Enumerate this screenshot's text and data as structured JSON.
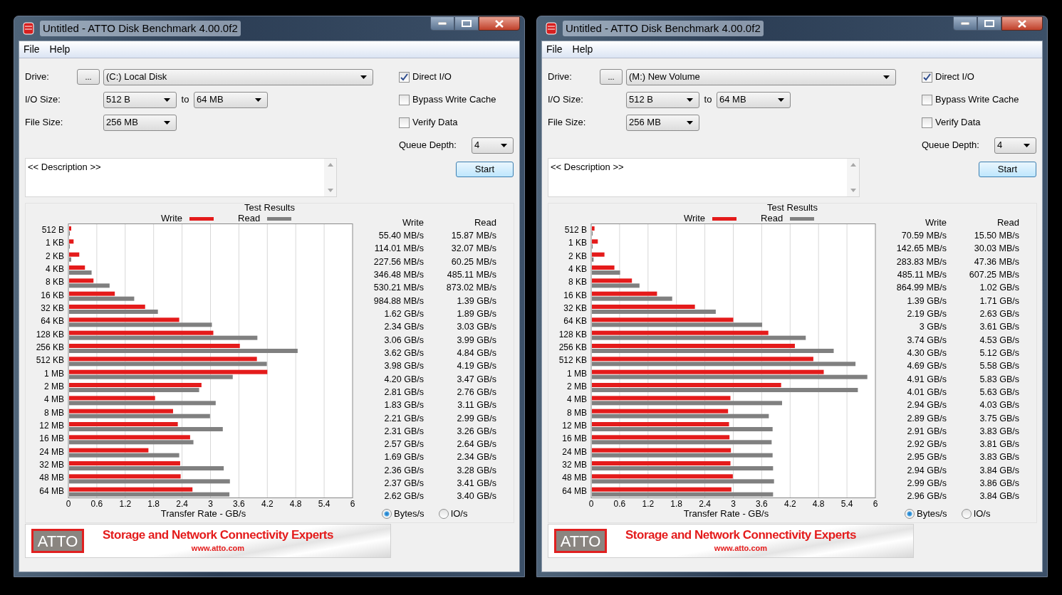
{
  "windows": [
    {
      "title": "Untitled - ATTO Disk Benchmark 4.00.0f2",
      "menu": [
        "File",
        "Help"
      ],
      "drive": {
        "label": "Drive:",
        "browse": "...",
        "value": "(C:) Local Disk"
      },
      "io_size": {
        "label": "I/O Size:",
        "from": "512 B",
        "to_label": "to",
        "to": "64 MB"
      },
      "file_size": {
        "label": "File Size:",
        "value": "256 MB"
      },
      "options": [
        {
          "label": "Direct I/O",
          "checked": true
        },
        {
          "label": "Bypass Write Cache",
          "checked": false
        },
        {
          "label": "Verify Data",
          "checked": false
        }
      ],
      "queue_depth": {
        "label": "Queue Depth:",
        "value": "4"
      },
      "description": "<< Description >>",
      "start": "Start",
      "results": {
        "title": "Test Results",
        "chart_data": {
          "type": "bar",
          "orientation": "horizontal",
          "grid": true,
          "legend": "top",
          "xlabel": "Transfer Rate - GB/s",
          "xlim": [
            0,
            6
          ],
          "xticks": [
            0,
            0.6,
            1.2,
            1.8,
            2.4,
            3,
            3.6,
            4.2,
            4.8,
            5.4,
            6
          ],
          "categories": [
            "512 B",
            "1 KB",
            "2 KB",
            "4 KB",
            "8 KB",
            "16 KB",
            "32 KB",
            "64 KB",
            "128 KB",
            "256 KB",
            "512 KB",
            "1 MB",
            "2 MB",
            "4 MB",
            "8 MB",
            "12 MB",
            "16 MB",
            "24 MB",
            "32 MB",
            "48 MB",
            "64 MB"
          ],
          "series": [
            {
              "name": "Write",
              "color": "#e41b1b",
              "values": [
                0.06,
                0.11,
                0.23,
                0.35,
                0.53,
                0.98,
                1.62,
                2.34,
                3.06,
                3.62,
                3.98,
                4.2,
                2.81,
                1.83,
                2.21,
                2.31,
                2.57,
                1.69,
                2.36,
                2.37,
                2.62
              ]
            },
            {
              "name": "Read",
              "color": "#808080",
              "values": [
                0.02,
                0.03,
                0.06,
                0.49,
                0.87,
                1.39,
                1.89,
                3.03,
                3.99,
                4.84,
                4.19,
                3.47,
                2.76,
                3.11,
                2.99,
                3.26,
                2.64,
                2.34,
                3.28,
                3.41,
                3.4
              ]
            }
          ]
        },
        "table": {
          "columns": [
            "Write",
            "Read"
          ],
          "rows": [
            [
              "55.40 MB/s",
              "15.87 MB/s"
            ],
            [
              "114.01 MB/s",
              "32.07 MB/s"
            ],
            [
              "227.56 MB/s",
              "60.25 MB/s"
            ],
            [
              "346.48 MB/s",
              "485.11 MB/s"
            ],
            [
              "530.21 MB/s",
              "873.02 MB/s"
            ],
            [
              "984.88 MB/s",
              "1.39 GB/s"
            ],
            [
              "1.62 GB/s",
              "1.89 GB/s"
            ],
            [
              "2.34 GB/s",
              "3.03 GB/s"
            ],
            [
              "3.06 GB/s",
              "3.99 GB/s"
            ],
            [
              "3.62 GB/s",
              "4.84 GB/s"
            ],
            [
              "3.98 GB/s",
              "4.19 GB/s"
            ],
            [
              "4.20 GB/s",
              "3.47 GB/s"
            ],
            [
              "2.81 GB/s",
              "2.76 GB/s"
            ],
            [
              "1.83 GB/s",
              "3.11 GB/s"
            ],
            [
              "2.21 GB/s",
              "2.99 GB/s"
            ],
            [
              "2.31 GB/s",
              "3.26 GB/s"
            ],
            [
              "2.57 GB/s",
              "2.64 GB/s"
            ],
            [
              "1.69 GB/s",
              "2.34 GB/s"
            ],
            [
              "2.36 GB/s",
              "3.28 GB/s"
            ],
            [
              "2.37 GB/s",
              "3.41 GB/s"
            ],
            [
              "2.62 GB/s",
              "3.40 GB/s"
            ]
          ]
        }
      },
      "units": [
        {
          "label": "Bytes/s",
          "selected": true
        },
        {
          "label": "IO/s",
          "selected": false
        }
      ],
      "banner": {
        "logo": "ATTO",
        "tagline": "Storage and Network Connectivity Experts",
        "url": "www.atto.com"
      }
    },
    {
      "title": "Untitled - ATTO Disk Benchmark 4.00.0f2",
      "menu": [
        "File",
        "Help"
      ],
      "drive": {
        "label": "Drive:",
        "browse": "...",
        "value": "(M:) New Volume"
      },
      "io_size": {
        "label": "I/O Size:",
        "from": "512 B",
        "to_label": "to",
        "to": "64 MB"
      },
      "file_size": {
        "label": "File Size:",
        "value": "256 MB"
      },
      "options": [
        {
          "label": "Direct I/O",
          "checked": true
        },
        {
          "label": "Bypass Write Cache",
          "checked": false
        },
        {
          "label": "Verify Data",
          "checked": false
        }
      ],
      "queue_depth": {
        "label": "Queue Depth:",
        "value": "4"
      },
      "description": "<< Description >>",
      "start": "Start",
      "results": {
        "title": "Test Results",
        "chart_data": {
          "type": "bar",
          "orientation": "horizontal",
          "grid": true,
          "legend": "top",
          "xlabel": "Transfer Rate - GB/s",
          "xlim": [
            0,
            6
          ],
          "xticks": [
            0,
            0.6,
            1.2,
            1.8,
            2.4,
            3,
            3.6,
            4.2,
            4.8,
            5.4,
            6
          ],
          "categories": [
            "512 B",
            "1 KB",
            "2 KB",
            "4 KB",
            "8 KB",
            "16 KB",
            "32 KB",
            "64 KB",
            "128 KB",
            "256 KB",
            "512 KB",
            "1 MB",
            "2 MB",
            "4 MB",
            "8 MB",
            "12 MB",
            "16 MB",
            "24 MB",
            "32 MB",
            "48 MB",
            "64 MB"
          ],
          "series": [
            {
              "name": "Write",
              "color": "#e41b1b",
              "values": [
                0.07,
                0.14,
                0.28,
                0.49,
                0.86,
                1.39,
                2.19,
                3,
                3.74,
                4.3,
                4.69,
                4.91,
                4.01,
                2.94,
                2.89,
                2.91,
                2.92,
                2.95,
                2.94,
                2.99,
                2.96
              ]
            },
            {
              "name": "Read",
              "color": "#808080",
              "values": [
                0.02,
                0.03,
                0.05,
                0.61,
                1.02,
                1.71,
                2.63,
                3.61,
                4.53,
                5.12,
                5.58,
                5.83,
                5.63,
                4.03,
                3.75,
                3.83,
                3.81,
                3.83,
                3.84,
                3.86,
                3.84
              ]
            }
          ]
        },
        "table": {
          "columns": [
            "Write",
            "Read"
          ],
          "rows": [
            [
              "70.59 MB/s",
              "15.50 MB/s"
            ],
            [
              "142.65 MB/s",
              "30.03 MB/s"
            ],
            [
              "283.83 MB/s",
              "47.36 MB/s"
            ],
            [
              "485.11 MB/s",
              "607.25 MB/s"
            ],
            [
              "864.99 MB/s",
              "1.02 GB/s"
            ],
            [
              "1.39 GB/s",
              "1.71 GB/s"
            ],
            [
              "2.19 GB/s",
              "2.63 GB/s"
            ],
            [
              "3 GB/s",
              "3.61 GB/s"
            ],
            [
              "3.74 GB/s",
              "4.53 GB/s"
            ],
            [
              "4.30 GB/s",
              "5.12 GB/s"
            ],
            [
              "4.69 GB/s",
              "5.58 GB/s"
            ],
            [
              "4.91 GB/s",
              "5.83 GB/s"
            ],
            [
              "4.01 GB/s",
              "5.63 GB/s"
            ],
            [
              "2.94 GB/s",
              "4.03 GB/s"
            ],
            [
              "2.89 GB/s",
              "3.75 GB/s"
            ],
            [
              "2.91 GB/s",
              "3.83 GB/s"
            ],
            [
              "2.92 GB/s",
              "3.81 GB/s"
            ],
            [
              "2.95 GB/s",
              "3.83 GB/s"
            ],
            [
              "2.94 GB/s",
              "3.84 GB/s"
            ],
            [
              "2.99 GB/s",
              "3.86 GB/s"
            ],
            [
              "2.96 GB/s",
              "3.84 GB/s"
            ]
          ]
        }
      },
      "units": [
        {
          "label": "Bytes/s",
          "selected": true
        },
        {
          "label": "IO/s",
          "selected": false
        }
      ],
      "banner": {
        "logo": "ATTO",
        "tagline": "Storage and Network Connectivity Experts",
        "url": "www.atto.com"
      }
    }
  ]
}
